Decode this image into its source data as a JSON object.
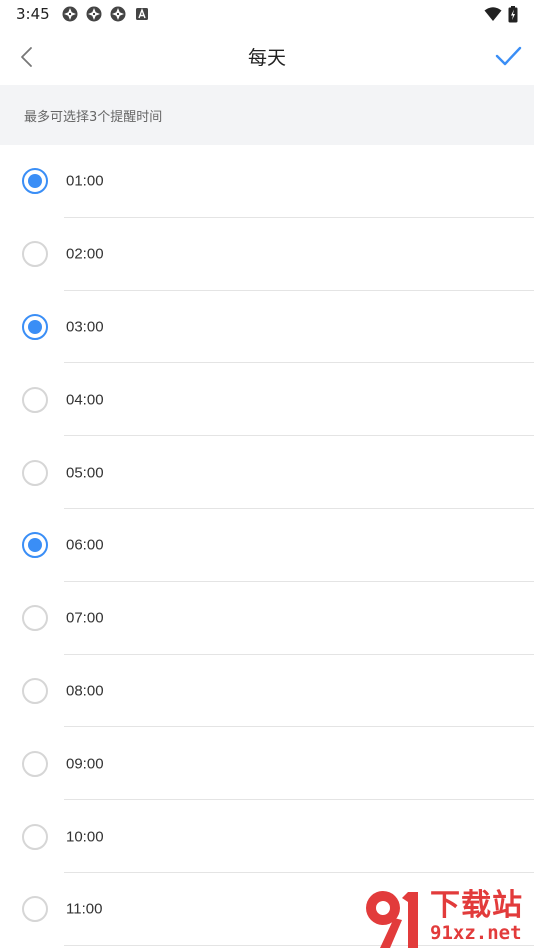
{
  "status_bar": {
    "time": "3:45",
    "notification_icons": [
      "notification-icon",
      "notification-icon",
      "notification-icon",
      "app-notification-icon"
    ],
    "right_icons": [
      "wifi-icon",
      "battery-icon"
    ]
  },
  "header": {
    "title": "每天",
    "back_icon": "chevron-left-icon",
    "confirm_icon": "checkmark-icon"
  },
  "hint": {
    "text": "最多可选择3个提醒时间"
  },
  "times": [
    {
      "label": "01:00",
      "checked": true
    },
    {
      "label": "02:00",
      "checked": false
    },
    {
      "label": "03:00",
      "checked": true
    },
    {
      "label": "04:00",
      "checked": false
    },
    {
      "label": "05:00",
      "checked": false
    },
    {
      "label": "06:00",
      "checked": true
    },
    {
      "label": "07:00",
      "checked": false
    },
    {
      "label": "08:00",
      "checked": false
    },
    {
      "label": "09:00",
      "checked": false
    },
    {
      "label": "10:00",
      "checked": false
    },
    {
      "label": "11:00",
      "checked": false
    }
  ],
  "watermark": {
    "title": "下载站",
    "url": "91xz.net"
  },
  "colors": {
    "accent": "#3a8ef6",
    "hint_bg": "#f3f4f6",
    "watermark": "#e23b3b"
  }
}
